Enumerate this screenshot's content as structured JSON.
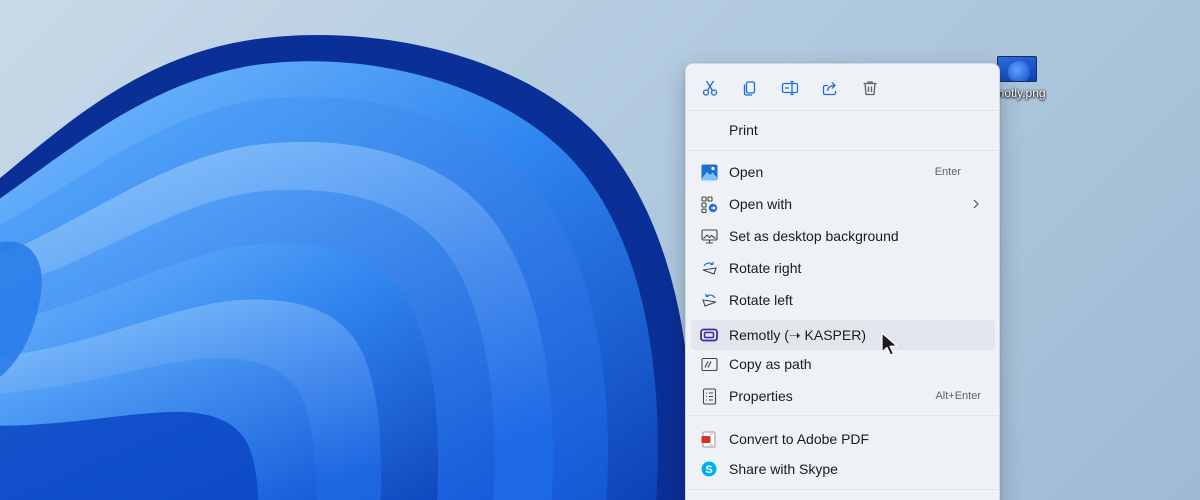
{
  "desktop": {
    "file_icon_label": "motly.png",
    "file_icon": "image-file-icon"
  },
  "context_menu": {
    "toolbar": [
      {
        "name": "cut",
        "icon": "scissors-icon"
      },
      {
        "name": "copy",
        "icon": "copy-icon"
      },
      {
        "name": "rename",
        "icon": "rename-icon"
      },
      {
        "name": "share",
        "icon": "share-icon"
      },
      {
        "name": "delete",
        "icon": "trash-icon"
      }
    ],
    "items": {
      "print": {
        "label": "Print"
      },
      "open": {
        "label": "Open",
        "shortcut": "Enter",
        "icon": "photos-icon"
      },
      "open_with": {
        "label": "Open with",
        "icon": "open-with-icon",
        "submenu": true
      },
      "set_background": {
        "label": "Set as desktop background",
        "icon": "desktop-background-icon"
      },
      "rotate_right": {
        "label": "Rotate right",
        "icon": "rotate-right-icon"
      },
      "rotate_left": {
        "label": "Rotate left",
        "icon": "rotate-left-icon"
      },
      "remotly": {
        "label": "Remotly (➝ KASPER)",
        "icon": "remotly-icon",
        "hovered": true
      },
      "copy_path": {
        "label": "Copy as path",
        "icon": "copy-path-icon"
      },
      "properties": {
        "label": "Properties",
        "shortcut": "Alt+Enter",
        "icon": "properties-icon"
      },
      "adobe_pdf": {
        "label": "Convert to Adobe PDF",
        "icon": "adobe-pdf-icon"
      },
      "skype": {
        "label": "Share with Skype",
        "icon": "skype-icon"
      }
    }
  },
  "colors": {
    "accent_blue": "#1f6fd1",
    "menu_bg": "#eef1f5",
    "hover_bg": "#e2e6ec",
    "remotly_purple": "#3b2ea0",
    "skype_blue": "#00aff0",
    "pdf_red": "#d93025"
  }
}
